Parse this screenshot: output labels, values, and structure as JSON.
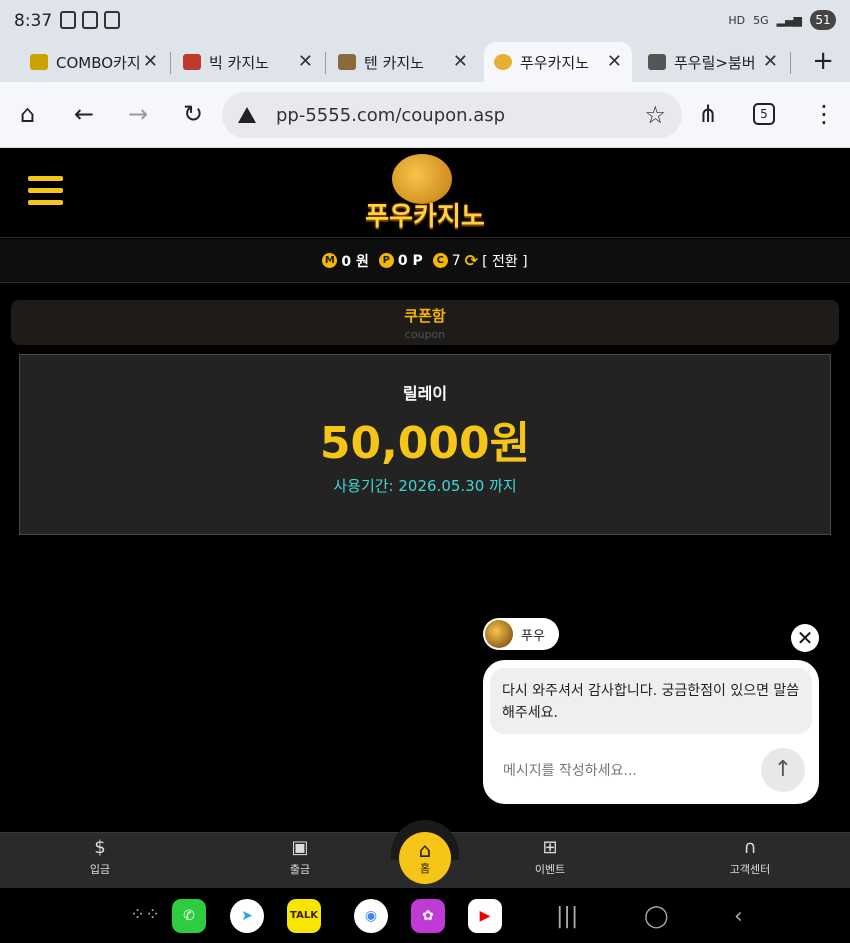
{
  "status_bar": {
    "time": "8:37",
    "battery": "51",
    "network": "5G",
    "hd": "HD"
  },
  "tabs": [
    {
      "title": "COMBO카지",
      "active": false
    },
    {
      "title": "빅 카지노",
      "active": false
    },
    {
      "title": "텐 카지노",
      "active": false
    },
    {
      "title": "푸우카지노",
      "active": true
    },
    {
      "title": "푸우릴>붐버",
      "active": false
    }
  ],
  "toolbar": {
    "url": "pp-5555.com/coupon.asp",
    "tab_count": "5"
  },
  "site": {
    "logo_text": "푸우카지노",
    "balances": {
      "money": "0 원",
      "points": "0 P",
      "coupons": "7",
      "switch_label": "[ 전환 ]"
    },
    "coin_letters": {
      "money": "M",
      "points": "P",
      "coupons": "C"
    }
  },
  "section": {
    "title": "쿠폰함",
    "subtitle": "coupon"
  },
  "coupon": {
    "name": "릴레이",
    "amount": "50,000원",
    "expiry": "사용기간: 2026.05.30 까지"
  },
  "chat": {
    "agent_name": "푸우",
    "message": "다시 와주셔서 감사합니다. 궁금한점이 있으면 말씀해주세요.",
    "input_placeholder": "메시지를 작성하세요..."
  },
  "bottom_nav": {
    "deposit": "입금",
    "withdraw": "출금",
    "home": "홈",
    "event": "이벤트",
    "support": "고객센터"
  },
  "colors": {
    "accent": "#f5c518",
    "expiry": "#3fd6d6"
  }
}
